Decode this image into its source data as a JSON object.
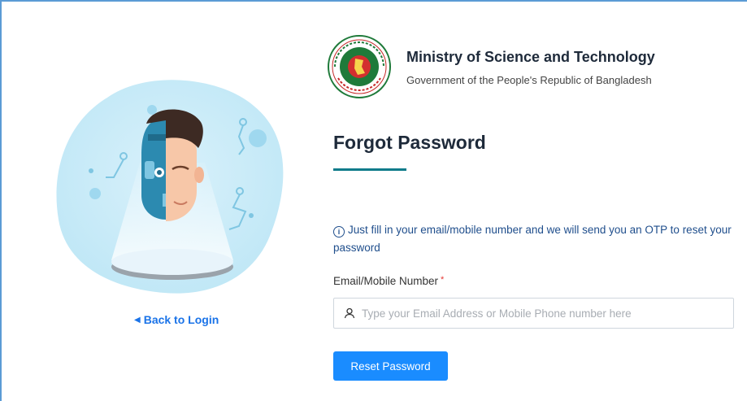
{
  "header": {
    "ministry_title": "Ministry of Science and Technology",
    "ministry_subtitle": "Government of the People's Republic of Bangladesh"
  },
  "page": {
    "title": "Forgot Password",
    "info_text": "Just fill in your email/mobile number and we will send you an OTP to reset your password"
  },
  "form": {
    "field_label": "Email/Mobile Number",
    "required_mark": "*",
    "placeholder": "Type your Email Address or Mobile Phone number here",
    "submit_label": "Reset Password"
  },
  "nav": {
    "back_label": "Back to Login"
  },
  "colors": {
    "accent": "#1a8cff",
    "title": "#1e2a3a",
    "underline": "#0f7b8a",
    "info": "#1f4e8c",
    "link": "#1a73e8"
  },
  "icons": [
    "bangladesh-govt-logo",
    "info-icon",
    "user-icon",
    "caret-left-icon"
  ]
}
